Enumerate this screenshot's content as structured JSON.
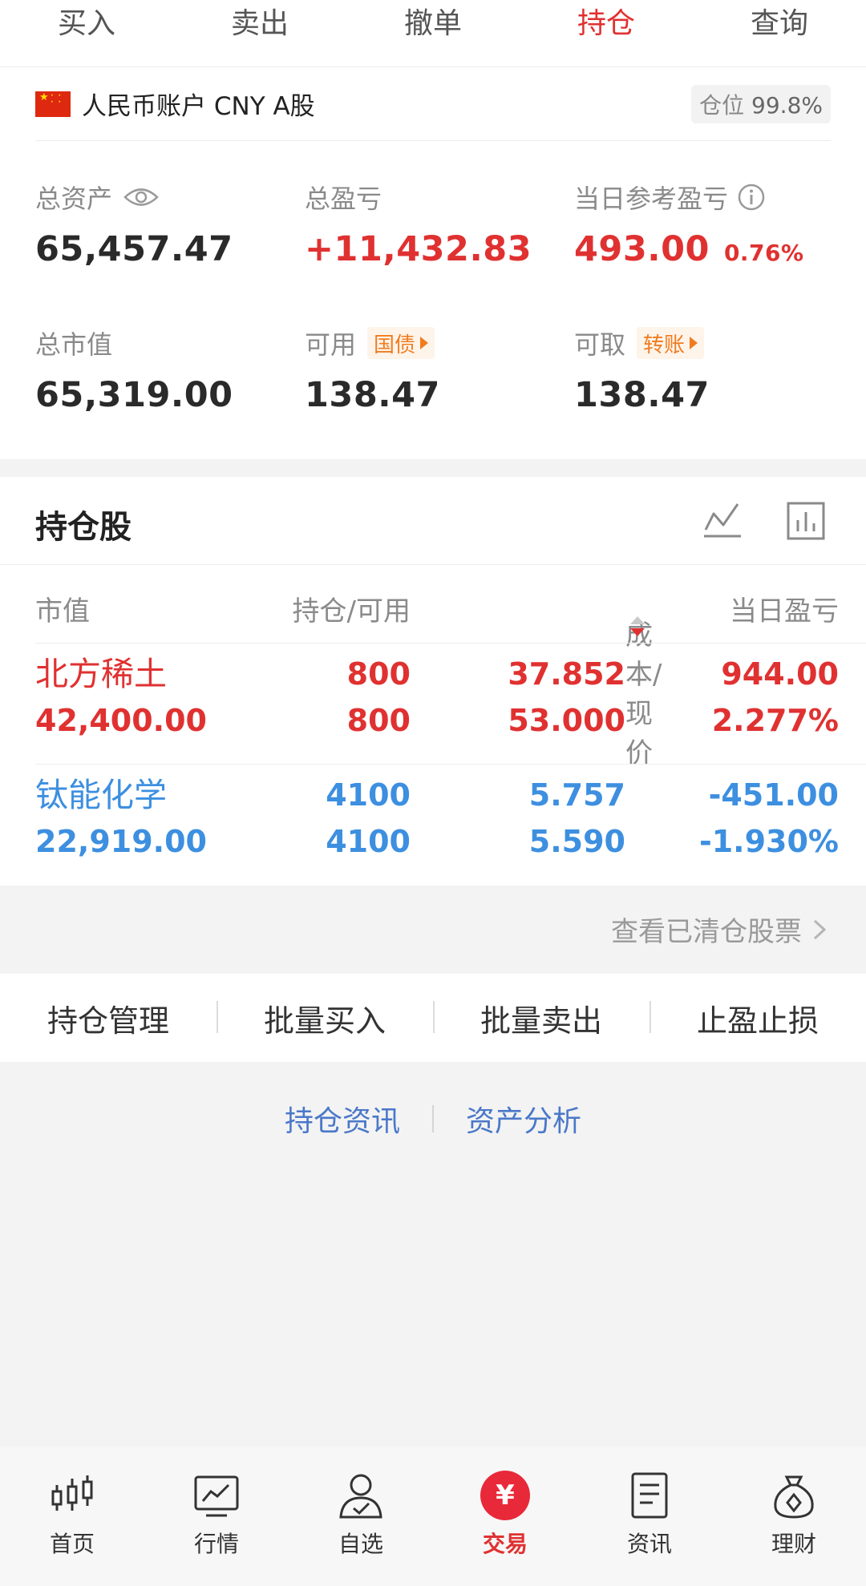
{
  "tabs": [
    {
      "label": "买入"
    },
    {
      "label": "卖出"
    },
    {
      "label": "撤单"
    },
    {
      "label": "持仓"
    },
    {
      "label": "查询"
    }
  ],
  "active_tab": "持仓",
  "account": {
    "label": "人民币账户 CNY A股",
    "position_label": "仓位",
    "position_value": "99.8%"
  },
  "summary": {
    "total_assets_label": "总资产",
    "total_assets": "65,457.47",
    "total_pnl_label": "总盈亏",
    "total_pnl": "+11,432.83",
    "today_pnl_label": "当日参考盈亏",
    "today_pnl": "493.00",
    "today_pnl_pct": "0.76%",
    "market_value_label": "总市值",
    "market_value": "65,319.00",
    "available_label": "可用",
    "available_chip": "国债",
    "available": "138.47",
    "withdrawable_label": "可取",
    "withdrawable_chip": "转账",
    "withdrawable": "138.47"
  },
  "holdings": {
    "title": "持仓股",
    "columns": {
      "market_value": "市值",
      "position": "持仓/可用",
      "cost_price": "成本/现价",
      "today_pnl": "当日盈亏"
    },
    "rows": [
      {
        "name": "北方稀土",
        "market_value": "42,400.00",
        "position": "800",
        "available": "800",
        "cost": "37.852",
        "price": "53.000",
        "pnl": "944.00",
        "pnl_pct": "2.277%"
      },
      {
        "name": "钛能化学",
        "market_value": "22,919.00",
        "position": "4100",
        "available": "4100",
        "cost": "5.757",
        "price": "5.590",
        "pnl": "-451.00",
        "pnl_pct": "-1.930%"
      }
    ]
  },
  "cleared_link": "查看已清仓股票",
  "actions": [
    "持仓管理",
    "批量买入",
    "批量卖出",
    "止盈止损"
  ],
  "links": [
    "持仓资讯",
    "资产分析"
  ],
  "bottom_nav": [
    {
      "label": "首页",
      "icon": "candlestick-icon"
    },
    {
      "label": "行情",
      "icon": "market-chart-icon"
    },
    {
      "label": "自选",
      "icon": "user-check-icon"
    },
    {
      "label": "交易",
      "icon": "yen-icon",
      "glyph": "¥"
    },
    {
      "label": "资讯",
      "icon": "document-icon"
    },
    {
      "label": "理财",
      "icon": "money-bag-icon"
    }
  ],
  "colors": {
    "accent_red": "#e03131",
    "loss_blue": "#3d8fe0",
    "chip_orange": "#f07c20",
    "link_blue": "#4a78c9"
  }
}
